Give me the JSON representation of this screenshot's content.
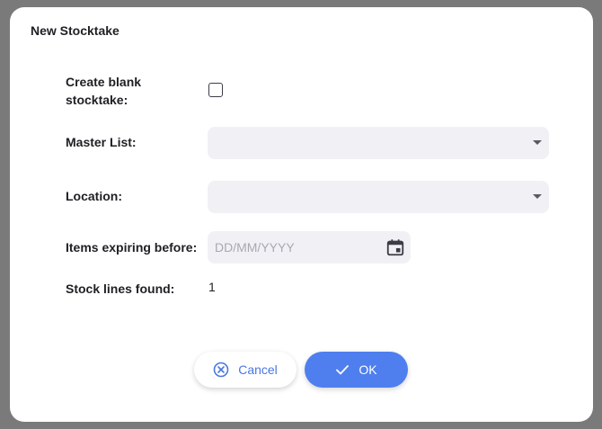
{
  "dialog": {
    "title": "New Stocktake"
  },
  "form": {
    "blank_label": "Create blank stocktake:",
    "blank_checked": false,
    "master_list_label": "Master List:",
    "master_list_value": "",
    "location_label": "Location:",
    "location_value": "",
    "expiry_label": "Items expiring before:",
    "expiry_placeholder": "DD/MM/YYYY",
    "stock_lines_label": "Stock lines found:",
    "stock_lines_value": "1"
  },
  "actions": {
    "cancel_label": "Cancel",
    "ok_label": "OK"
  },
  "colors": {
    "primary": "#4f7fee",
    "field_bg": "#f1f1f5",
    "overlay": "#7a7a7a"
  },
  "icons": {
    "cancel": "cancel-circle-icon",
    "ok": "check-icon",
    "calendar": "calendar-icon",
    "dropdown": "chevron-down-icon"
  }
}
